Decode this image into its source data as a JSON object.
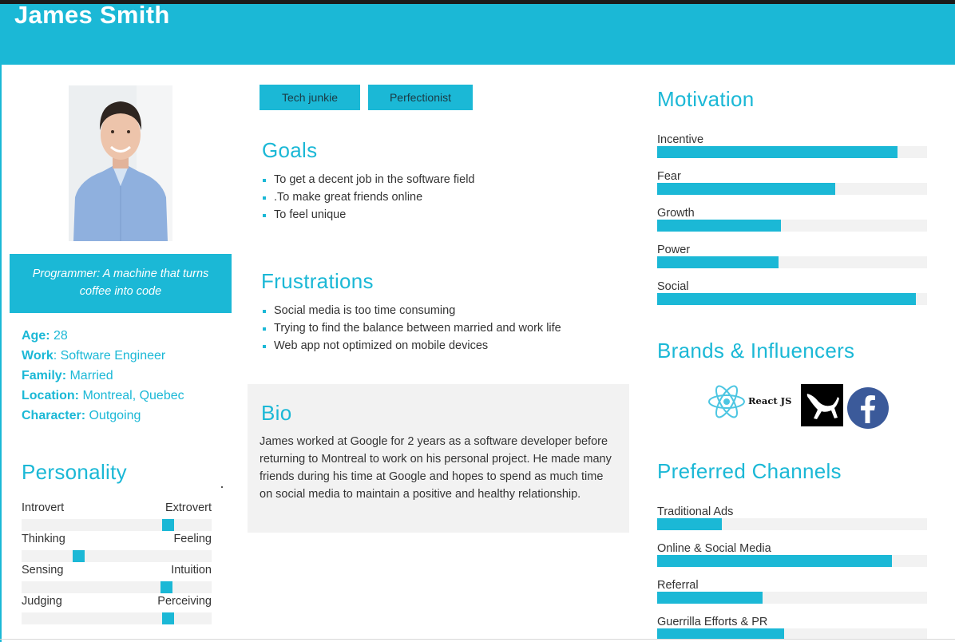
{
  "header": {
    "name": "James Smith"
  },
  "profile": {
    "quote": "Programmer: A machine that turns coffee into code",
    "facts": [
      {
        "key": "Age:",
        "value": " 28"
      },
      {
        "key": "Work",
        "value": ": Software Engineer"
      },
      {
        "key": "Family:",
        "value": " Married"
      },
      {
        "key": "Location:",
        "value": " Montreal, Quebec"
      },
      {
        "key": "Character:",
        "value": " Outgoing"
      }
    ]
  },
  "personality": {
    "title": "Personality",
    "traits": [
      {
        "left": "Introvert",
        "right": "Extrovert",
        "position": 0.77
      },
      {
        "left": "Thinking",
        "right": "Feeling",
        "position": 0.3
      },
      {
        "left": "Sensing",
        "right": "Intuition",
        "position": 0.76
      },
      {
        "left": "Judging",
        "right": "Perceiving",
        "position": 0.77
      }
    ]
  },
  "tags": [
    "Tech junkie",
    "Perfectionist"
  ],
  "goals": {
    "title": "Goals",
    "items": [
      "To get a decent job in the software field",
      ".To make great friends online",
      "To feel unique"
    ]
  },
  "frustrations": {
    "title": "Frustrations",
    "items": [
      "Social media is too time consuming",
      "Trying to find the balance between married and work life",
      "Web app not optimized on mobile devices"
    ]
  },
  "bio": {
    "title": "Bio",
    "text": "James worked at Google for 2 years as a software developer before returning to Montreal to work on his personal project. He made many friends during his time at Google and hopes to spend as much time on social media to maintain a positive and healthy relationship."
  },
  "motivation": {
    "title": "Motivation",
    "items": [
      {
        "label": "Incentive",
        "level": 0.89
      },
      {
        "label": "Fear",
        "level": 0.66
      },
      {
        "label": "Growth",
        "level": 0.46
      },
      {
        "label": "Power",
        "level": 0.45
      },
      {
        "label": "Social",
        "level": 0.96
      }
    ]
  },
  "brands": {
    "title": "Brands & Influencers",
    "react_label": "React JS",
    "icons": [
      "react-logo-icon",
      "puma-logo-icon",
      "facebook-logo-icon"
    ]
  },
  "channels": {
    "title": "Preferred Channels",
    "items": [
      {
        "label": "Traditional Ads",
        "level": 0.24
      },
      {
        "label": "Online & Social Media",
        "level": 0.87
      },
      {
        "label": "Referral",
        "level": 0.39
      },
      {
        "label": "Guerrilla Efforts & PR",
        "level": 0.47
      }
    ]
  },
  "colors": {
    "accent": "#1bb8d6",
    "panel": "#f2f2f2",
    "text": "#333333"
  }
}
